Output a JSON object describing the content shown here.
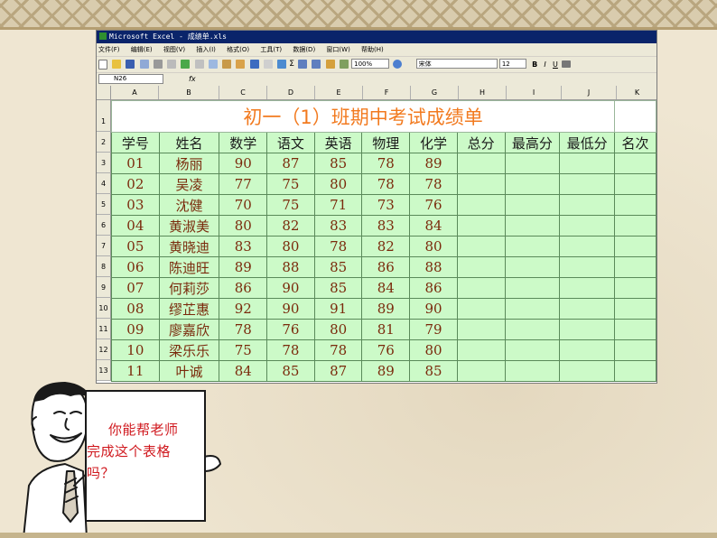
{
  "window": {
    "title": "Microsoft Excel - 成绩单.xls"
  },
  "menu": [
    "文件(F)",
    "编辑(E)",
    "视图(V)",
    "插入(I)",
    "格式(O)",
    "工具(T)",
    "数据(D)",
    "窗口(W)",
    "帮助(H)"
  ],
  "toolbar": {
    "zoom": "100%",
    "font_name": "宋体",
    "font_size": "12",
    "bold": "B",
    "italic": "I",
    "underline": "U",
    "sigma": "Σ"
  },
  "formula_bar": {
    "name_box": "N26",
    "fx": "fx"
  },
  "columns": [
    "A",
    "B",
    "C",
    "D",
    "E",
    "F",
    "G",
    "H",
    "I",
    "J",
    "K"
  ],
  "rows": [
    "1",
    "2",
    "3",
    "4",
    "5",
    "6",
    "7",
    "8",
    "9",
    "10",
    "11",
    "12",
    "13"
  ],
  "sheet": {
    "title": "初一（1）班期中考试成绩单",
    "headers": [
      "学号",
      "姓名",
      "数学",
      "语文",
      "英语",
      "物理",
      "化学",
      "总分",
      "最高分",
      "最低分",
      "名次"
    ],
    "data": [
      [
        "01",
        "杨丽",
        "90",
        "87",
        "85",
        "78",
        "89"
      ],
      [
        "02",
        "吴凌",
        "77",
        "75",
        "80",
        "78",
        "78"
      ],
      [
        "03",
        "沈健",
        "70",
        "75",
        "71",
        "73",
        "76"
      ],
      [
        "04",
        "黄淑美",
        "80",
        "82",
        "83",
        "83",
        "84"
      ],
      [
        "05",
        "黄晓迪",
        "83",
        "80",
        "78",
        "82",
        "80"
      ],
      [
        "06",
        "陈迪旺",
        "89",
        "88",
        "85",
        "86",
        "88"
      ],
      [
        "07",
        "何莉莎",
        "86",
        "90",
        "85",
        "84",
        "86"
      ],
      [
        "08",
        "缪芷惠",
        "92",
        "90",
        "91",
        "89",
        "90"
      ],
      [
        "09",
        "廖嘉欣",
        "78",
        "76",
        "80",
        "81",
        "79"
      ],
      [
        "10",
        "梁乐乐",
        "75",
        "78",
        "78",
        "76",
        "80"
      ],
      [
        "11",
        "叶诚",
        "84",
        "85",
        "87",
        "89",
        "85"
      ]
    ]
  },
  "speech": {
    "text": "你能帮老师完成这个表格吗？"
  },
  "colors": {
    "title_orange": "#f27a1f",
    "cell_green": "#ccfac8",
    "speech_red": "#d0181e",
    "titlebar_blue": "#0a246a"
  }
}
